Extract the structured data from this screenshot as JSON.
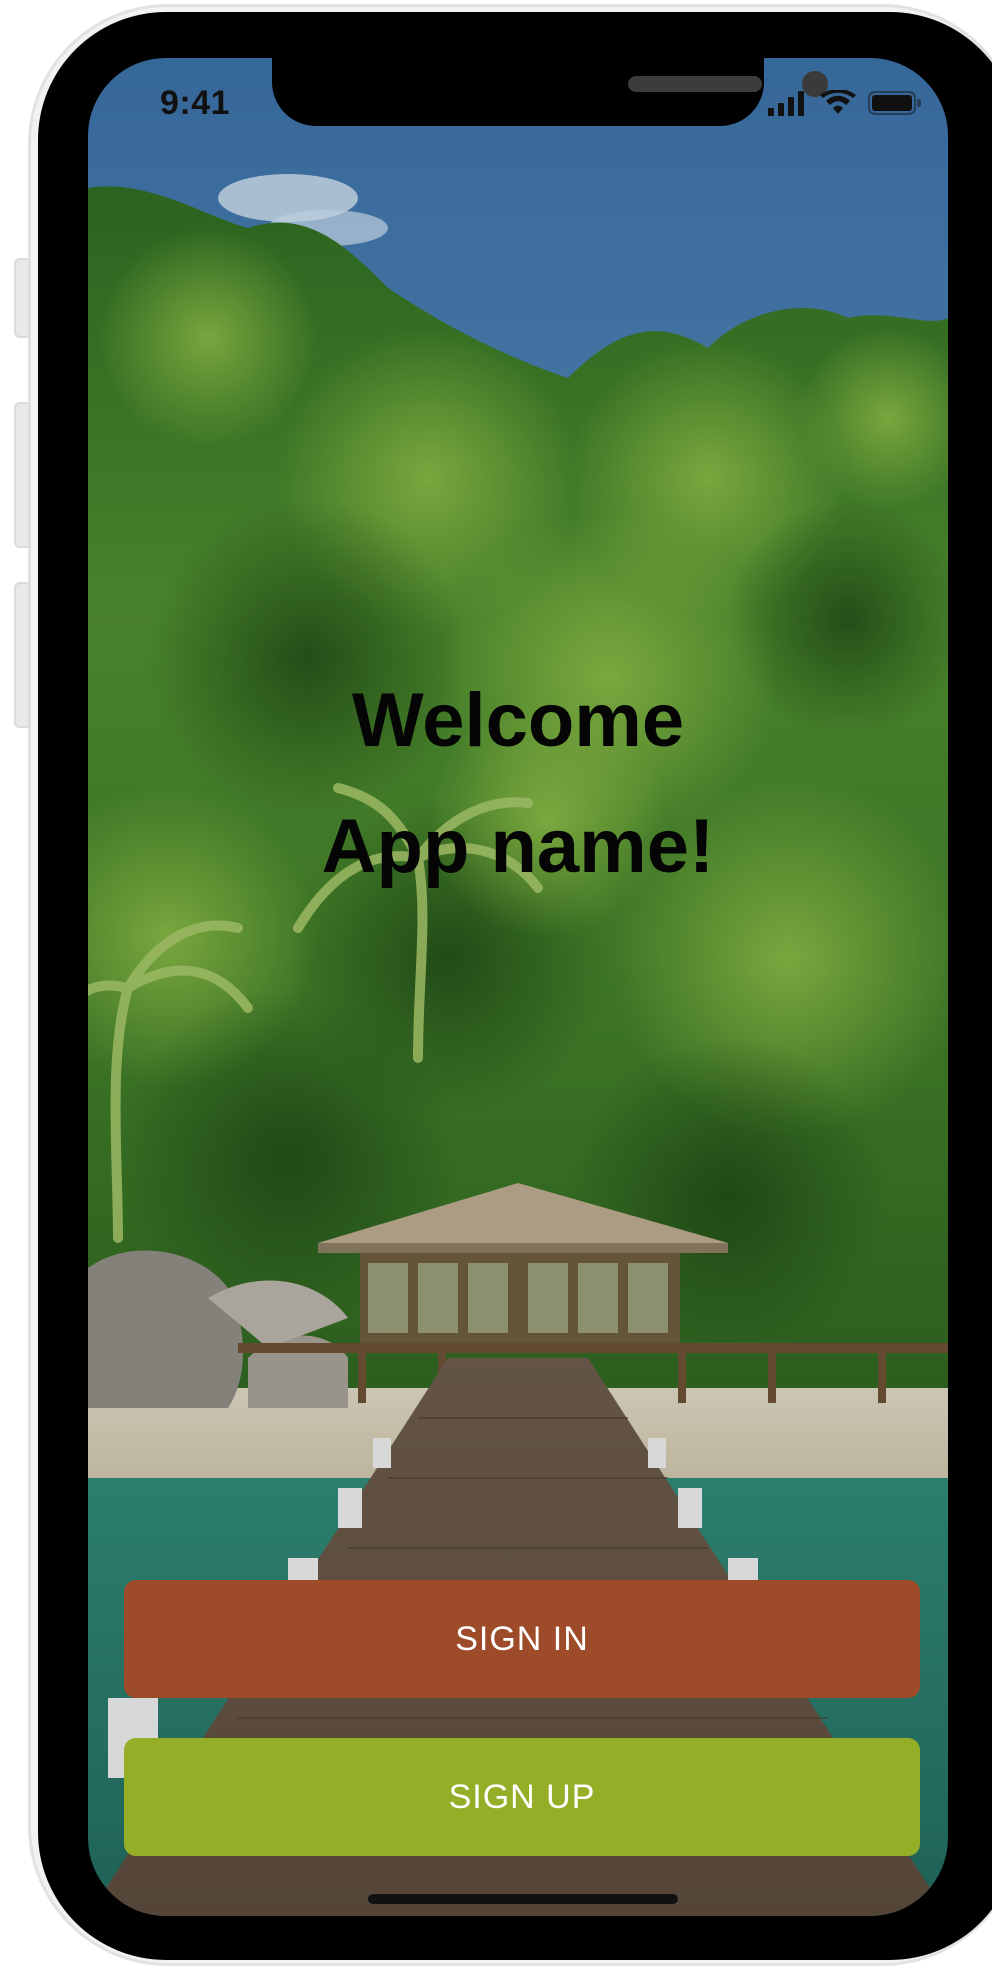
{
  "status_bar": {
    "time": "9:41",
    "icons": [
      "cellular-signal-icon",
      "wifi-icon",
      "battery-icon"
    ]
  },
  "welcome": {
    "line1": "Welcome",
    "line2": "App name!"
  },
  "buttons": {
    "sign_in": "SIGN IN",
    "sign_up": "SIGN UP"
  },
  "colors": {
    "sign_in_bg": "#9e4b2a",
    "sign_up_bg": "#94ae28",
    "sky": "#3d72a6",
    "forest": "#3f7d2a",
    "water": "#2f8a78"
  },
  "background_image": "tropical-beach-jetty-photo"
}
